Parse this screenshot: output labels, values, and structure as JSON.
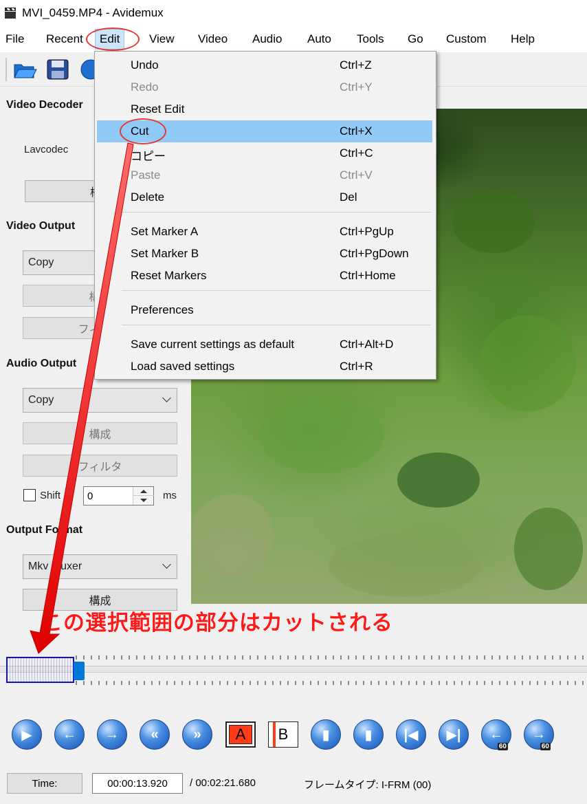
{
  "window": {
    "title": "MVI_0459.MP4 - Avidemux"
  },
  "menubar": {
    "items": [
      "File",
      "Recent",
      "Edit",
      "View",
      "Video",
      "Audio",
      "Auto",
      "Tools",
      "Go",
      "Custom",
      "Help"
    ]
  },
  "left_panel": {
    "video_decoder": {
      "heading": "Video Decoder",
      "codec": "Lavcodec",
      "config_button": "構成"
    },
    "video_output": {
      "heading": "Video Output",
      "codec_selected": "Copy",
      "config_button": "構成",
      "filter_button": "フィルタ"
    },
    "audio_output": {
      "heading": "Audio Output",
      "codec_selected": "Copy",
      "config_button": "構成",
      "filter_button": "フィルタ",
      "shift_label": "Shift",
      "shift_value": "0",
      "shift_unit": "ms",
      "shift_checked": false
    },
    "output_format": {
      "heading": "Output Format",
      "muxer_selected": "Mkv Muxer",
      "config_button": "構成"
    }
  },
  "edit_menu": {
    "items": [
      {
        "label": "Undo",
        "shortcut": "Ctrl+Z",
        "enabled": true
      },
      {
        "label": "Redo",
        "shortcut": "Ctrl+Y",
        "enabled": false
      },
      {
        "label": "Reset Edit",
        "shortcut": "",
        "enabled": true
      },
      {
        "label": "Cut",
        "shortcut": "Ctrl+X",
        "enabled": true,
        "highlighted": true
      },
      {
        "label": "コピー",
        "shortcut": "Ctrl+C",
        "enabled": true
      },
      {
        "label": "Paste",
        "shortcut": "Ctrl+V",
        "enabled": false
      },
      {
        "label": "Delete",
        "shortcut": "Del",
        "enabled": true
      },
      {
        "label": "Set Marker A",
        "shortcut": "Ctrl+PgUp",
        "enabled": true
      },
      {
        "label": "Set Marker B",
        "shortcut": "Ctrl+PgDown",
        "enabled": true
      },
      {
        "label": "Reset Markers",
        "shortcut": "Ctrl+Home",
        "enabled": true
      },
      {
        "label": "Preferences",
        "shortcut": "",
        "enabled": true
      },
      {
        "label": "Save current settings as default",
        "shortcut": "Ctrl+Alt+D",
        "enabled": true
      },
      {
        "label": "Load saved settings",
        "shortcut": "Ctrl+R",
        "enabled": true
      }
    ]
  },
  "annotation": {
    "text": "この選択範囲の部分はカットされる",
    "color": "#ff1a1a"
  },
  "navigation": {
    "marker_a": "A",
    "marker_b": "B",
    "sub_label_60": "60"
  },
  "status": {
    "time_button": "Time:",
    "current_time": "00:00:13.920",
    "total_time": "/ 00:02:21.680",
    "frame_type": "フレームタイプ:  I-FRM (00)"
  },
  "colors": {
    "accent": "#0078d7",
    "highlight": "#91c9f7",
    "annotation_red": "#e53935"
  }
}
